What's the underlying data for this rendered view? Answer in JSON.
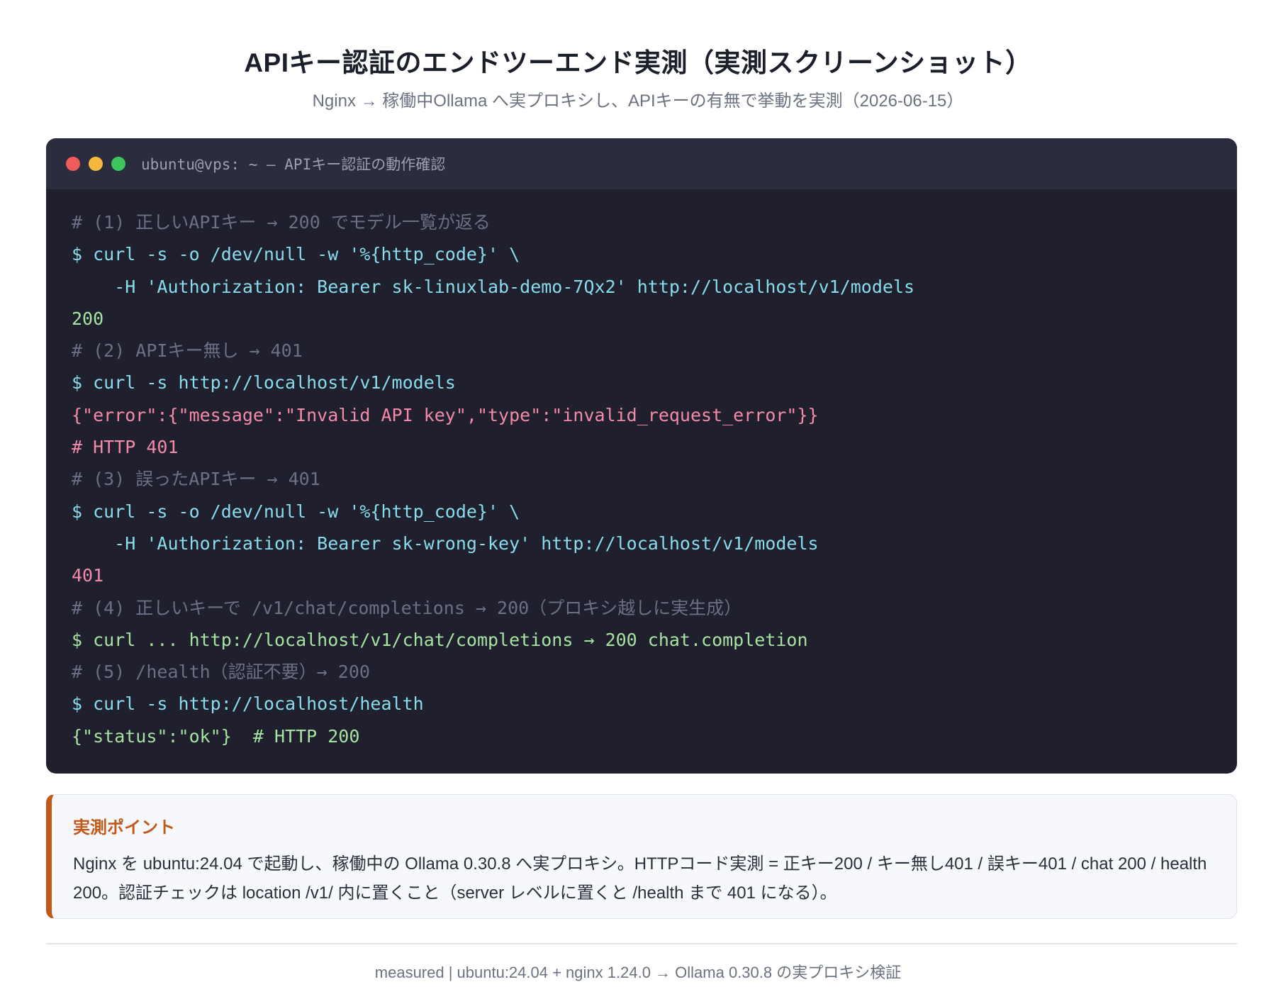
{
  "header": {
    "title": "APIキー認証のエンドツーエンド実測（実測スクリーンショット）",
    "subtitle": "Nginx → 稼働中Ollama へ実プロキシし、APIキーの有無で挙動を実測（2026-06-15）"
  },
  "terminal": {
    "window_title": "ubuntu@vps: ~ — APIキー認証の動作確認",
    "lines": [
      {
        "kind": "comment",
        "text": "# (1) 正しいAPIキー → 200 でモデル一覧が返る"
      },
      {
        "kind": "cmd",
        "text": "$ curl -s -o /dev/null -w '%{http_code}' \\"
      },
      {
        "kind": "cmd",
        "text": "    -H 'Authorization: Bearer sk-linuxlab-demo-7Qx2' http://localhost/v1/models"
      },
      {
        "kind": "ok",
        "text": "200"
      },
      {
        "kind": "comment",
        "text": "# (2) APIキー無し → 401"
      },
      {
        "kind": "cmd",
        "text": "$ curl -s http://localhost/v1/models"
      },
      {
        "kind": "err",
        "text": "{\"error\":{\"message\":\"Invalid API key\",\"type\":\"invalid_request_error\"}}"
      },
      {
        "kind": "err",
        "text": "# HTTP 401"
      },
      {
        "kind": "comment",
        "text": "# (3) 誤ったAPIキー → 401"
      },
      {
        "kind": "cmd",
        "text": "$ curl -s -o /dev/null -w '%{http_code}' \\"
      },
      {
        "kind": "cmd",
        "text": "    -H 'Authorization: Bearer sk-wrong-key' http://localhost/v1/models"
      },
      {
        "kind": "err",
        "text": "401"
      },
      {
        "kind": "comment",
        "text": "# (4) 正しいキーで /v1/chat/completions → 200（プロキシ越しに実生成）"
      },
      {
        "kind": "ok",
        "text": "$ curl ... http://localhost/v1/chat/completions → 200 chat.completion"
      },
      {
        "kind": "comment",
        "text": "# (5) /health（認証不要）→ 200"
      },
      {
        "kind": "cmd",
        "text": "$ curl -s http://localhost/health"
      },
      {
        "kind": "ok",
        "text": "{\"status\":\"ok\"}  # HTTP 200"
      }
    ]
  },
  "callout": {
    "heading": "実測ポイント",
    "body": "Nginx を ubuntu:24.04 で起動し、稼働中の Ollama 0.30.8 へ実プロキシ。HTTPコード実測 = 正キー200 / キー無し401 / 誤キー401 / chat 200 / health 200。認証チェックは location /v1/ 内に置くこと（server レベルに置くと /health まで 401 になる）。"
  },
  "footer": {
    "text": "measured | ubuntu:24.04 + nginx 1.24.0 → Ollama 0.30.8 の実プロキシ検証"
  },
  "colors": {
    "terminal_bg": "#1f1f2e",
    "titlebar_bg": "#2b2c3e",
    "comment": "#6c7086",
    "command": "#89dceb",
    "success": "#a6e3a1",
    "error": "#f38ba8",
    "accent": "#c2591b"
  }
}
